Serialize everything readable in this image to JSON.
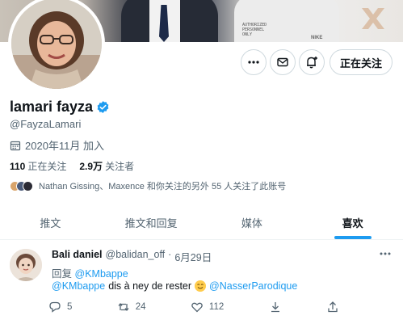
{
  "banner": {
    "hoodie_text": [
      "AUTHORIZED",
      "PERSONNEL",
      "ONLY"
    ],
    "hoodie_brand": "NIKE"
  },
  "profile": {
    "display_name": "lamari fayza",
    "handle": "@FayzaLamari",
    "joined": "2020年11月 加入",
    "following_count": "110",
    "following_label": "正在关注",
    "followers_count": "2.9万",
    "followers_label": "关注者",
    "followed_by": "Nathan Gissing、Maxence 和你关注的另外 55 人关注了此账号"
  },
  "actions": {
    "following_button": "正在关注"
  },
  "tabs": [
    {
      "label": "推文",
      "active": false
    },
    {
      "label": "推文和回复",
      "active": false
    },
    {
      "label": "媒体",
      "active": false
    },
    {
      "label": "喜欢",
      "active": true
    }
  ],
  "tweet": {
    "author": "Bali daniel",
    "handle": "@balidan_off",
    "separator": "·",
    "date": "6月29日",
    "reply_prefix": "回复",
    "reply_to": "@KMbappe",
    "mention_1": "@KMbappe",
    "body": "dis à ney de rester",
    "mention_2": "@NasserParodique",
    "replies": "5",
    "retweets": "24",
    "likes": "112"
  },
  "colors": {
    "accent": "#1d9bf0",
    "text": "#0f1419",
    "muted": "#536471",
    "border": "#cfd9de"
  }
}
